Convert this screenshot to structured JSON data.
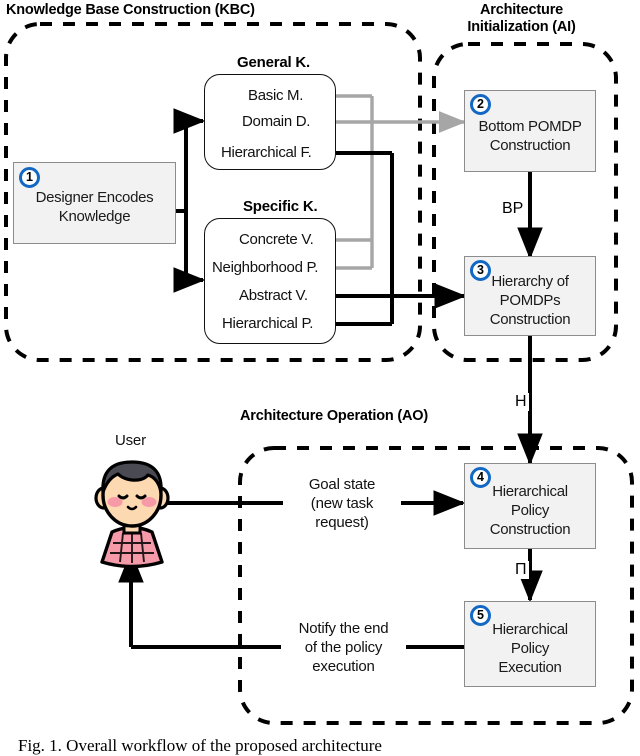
{
  "figure": {
    "caption": "Fig. 1.  Overall workflow of the proposed architecture"
  },
  "regions": [
    {
      "id": "kbc",
      "title": "Knowledge Base Construction (KBC)"
    },
    {
      "id": "ai",
      "title": "Architecture\nInitialization (AI)"
    },
    {
      "id": "ao",
      "title": "Architecture Operation (AO)"
    }
  ],
  "knowledge_groups": [
    {
      "id": "general",
      "label": "General K.",
      "items": [
        {
          "label": "Basic M.",
          "link": "gray"
        },
        {
          "label": "Domain D.",
          "link": "gray"
        },
        {
          "label": "Hierarchical F.",
          "link": "black"
        }
      ]
    },
    {
      "id": "specific",
      "label": "Specific K.",
      "items": [
        {
          "label": "Concrete V.",
          "link": "gray"
        },
        {
          "label": "Neighborhood P.",
          "link": "gray"
        },
        {
          "label": "Abstract V.",
          "link": "black"
        },
        {
          "label": "Hierarchical P.",
          "link": "black"
        }
      ]
    }
  ],
  "processes": [
    {
      "number": "1",
      "text": "Designer Encodes\nKnowledge"
    },
    {
      "number": "2",
      "text": "Bottom POMDP\nConstruction"
    },
    {
      "number": "3",
      "text": "Hierarchy of\nPOMDPs\nConstruction"
    },
    {
      "number": "4",
      "text": "Hierarchical\nPolicy\nConstruction"
    },
    {
      "number": "5",
      "text": "Hierarchical\nPolicy\nExecution"
    }
  ],
  "edge_labels": {
    "bp": "BP",
    "h": "H",
    "pi": "Π",
    "goal_state": "Goal state\n(new task\nrequest)",
    "notify": "Notify the end\nof the policy\nexecution"
  },
  "actor": {
    "label": "User",
    "name": "user-avatar",
    "colors": {
      "hair": "#4a4a52",
      "skin": "#fcd9b0",
      "cheek": "#f79aa8",
      "shirt": "#f49aa8",
      "outline": "#000000"
    }
  },
  "colors": {
    "accent_badge": "#1268c3",
    "box_fill": "#f2f2f2",
    "box_border": "#8c8c8c",
    "line_black": "#000000",
    "line_gray": "#a6a6a6",
    "dashed_border": "#000000"
  }
}
